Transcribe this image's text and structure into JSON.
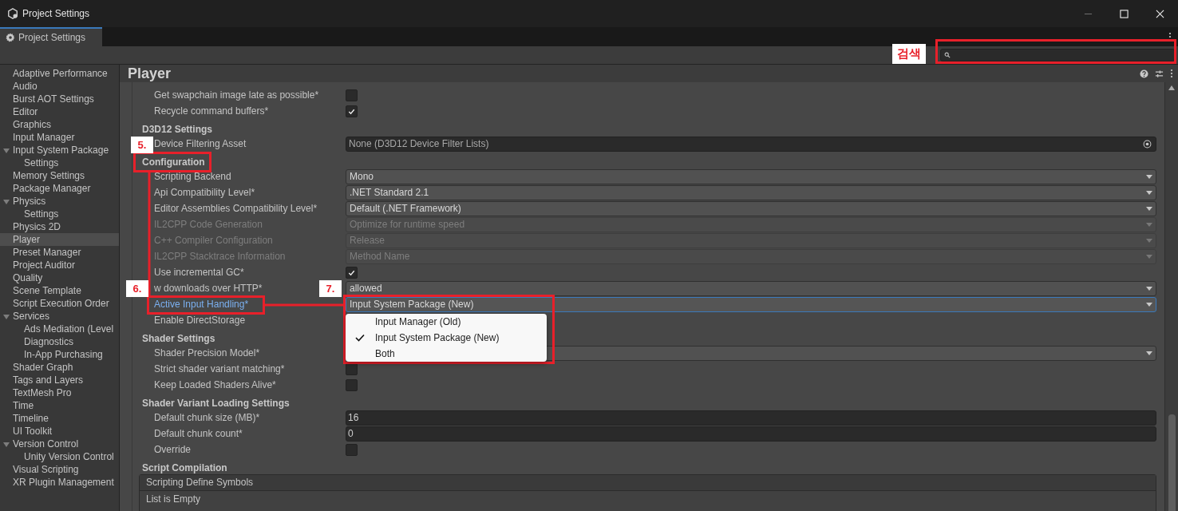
{
  "window": {
    "title": "Project Settings"
  },
  "tab": {
    "label": "Project Settings",
    "selected": true
  },
  "sidebar": {
    "items": [
      {
        "label": "Adaptive Performance",
        "selected": false
      },
      {
        "label": "Audio",
        "selected": false
      },
      {
        "label": "Burst AOT Settings",
        "selected": false
      },
      {
        "label": "Editor",
        "selected": false
      },
      {
        "label": "Graphics",
        "selected": false
      },
      {
        "label": "Input Manager",
        "selected": false
      },
      {
        "label": "Input System Package",
        "selected": false,
        "expanded": true,
        "children": [
          {
            "label": "Settings",
            "selected": false
          }
        ]
      },
      {
        "label": "Memory Settings",
        "selected": false
      },
      {
        "label": "Package Manager",
        "selected": false
      },
      {
        "label": "Physics",
        "selected": false,
        "expanded": true,
        "children": [
          {
            "label": "Settings",
            "selected": false
          }
        ]
      },
      {
        "label": "Physics 2D",
        "selected": false
      },
      {
        "label": "Player",
        "selected": true
      },
      {
        "label": "Preset Manager",
        "selected": false
      },
      {
        "label": "Project Auditor",
        "selected": false
      },
      {
        "label": "Quality",
        "selected": false
      },
      {
        "label": "Scene Template",
        "selected": false
      },
      {
        "label": "Script Execution Order",
        "selected": false
      },
      {
        "label": "Services",
        "selected": false,
        "expanded": true,
        "children": [
          {
            "label": "Ads Mediation (Level",
            "selected": false
          },
          {
            "label": "Diagnostics",
            "selected": false
          },
          {
            "label": "In-App Purchasing",
            "selected": false
          }
        ]
      },
      {
        "label": "Shader Graph",
        "selected": false
      },
      {
        "label": "Tags and Layers",
        "selected": false
      },
      {
        "label": "TextMesh Pro",
        "selected": false
      },
      {
        "label": "Time",
        "selected": false
      },
      {
        "label": "Timeline",
        "selected": false
      },
      {
        "label": "UI Toolkit",
        "selected": false
      },
      {
        "label": "Version Control",
        "selected": false,
        "expanded": true,
        "children": [
          {
            "label": "Unity Version Control",
            "selected": false
          }
        ]
      },
      {
        "label": "Visual Scripting",
        "selected": false
      },
      {
        "label": "XR Plugin Management",
        "selected": false
      }
    ]
  },
  "page": {
    "title": "Player",
    "rows": [
      {
        "kind": "checkbox",
        "label": "Get swapchain image late as possible*",
        "checked": false
      },
      {
        "kind": "checkbox",
        "label": "Recycle command buffers*",
        "checked": true
      },
      {
        "kind": "header",
        "label": "D3D12 Settings"
      },
      {
        "kind": "object",
        "label": "Device Filtering Asset",
        "value": "None (D3D12 Device Filter Lists)"
      },
      {
        "kind": "header",
        "label": "Configuration"
      },
      {
        "kind": "dropdown",
        "label": "Scripting Backend",
        "value": "Mono",
        "disabled": false,
        "focused": false
      },
      {
        "kind": "dropdown",
        "label": "Api Compatibility Level*",
        "value": ".NET Standard 2.1",
        "disabled": false,
        "focused": false
      },
      {
        "kind": "dropdown",
        "label": "Editor Assemblies Compatibility Level*",
        "value": "Default (.NET Framework)",
        "disabled": false,
        "focused": false
      },
      {
        "kind": "dropdown",
        "label": "IL2CPP Code Generation",
        "value": "Optimize for runtime speed",
        "disabled": true,
        "focused": false
      },
      {
        "kind": "dropdown",
        "label": "C++ Compiler Configuration",
        "value": "Release",
        "disabled": true,
        "focused": false
      },
      {
        "kind": "dropdown",
        "label": "IL2CPP Stacktrace Information",
        "value": "Method Name",
        "disabled": true,
        "focused": false
      },
      {
        "kind": "checkbox",
        "label": "Use incremental GC*",
        "checked": true
      },
      {
        "kind": "dropdown",
        "label": "w downloads over HTTP*",
        "value": "allowed",
        "disabled": false,
        "focused": false
      },
      {
        "kind": "dropdown",
        "label": "Active Input Handling*",
        "value": "Input System Package (New)",
        "disabled": false,
        "focused": true
      },
      {
        "kind": "plain",
        "label": "Enable DirectStorage"
      },
      {
        "kind": "header",
        "label": "Shader Settings"
      },
      {
        "kind": "dropdown",
        "label": "Shader Precision Model*",
        "disabled": false,
        "focused": false
      },
      {
        "kind": "checkbox",
        "label": "Strict shader variant matching*",
        "checked": false
      },
      {
        "kind": "checkbox",
        "label": "Keep Loaded Shaders Alive*",
        "checked": false
      },
      {
        "kind": "header",
        "label": "Shader Variant Loading Settings"
      },
      {
        "kind": "number",
        "label": "Default chunk size (MB)*",
        "value": "16"
      },
      {
        "kind": "number",
        "label": "Default chunk count*",
        "value": "0"
      },
      {
        "kind": "checkbox",
        "label": "Override",
        "checked": false
      },
      {
        "kind": "header",
        "label": "Script Compilation"
      },
      {
        "kind": "list",
        "label": "Scripting Define Symbols",
        "empty_text": "List is Empty"
      }
    ]
  },
  "popup": {
    "items": [
      {
        "label": "Input Manager (Old)",
        "selected": false
      },
      {
        "label": "Input System Package (New)",
        "selected": true
      },
      {
        "label": "Both",
        "selected": false
      }
    ]
  },
  "annotations": {
    "search_label": "검색",
    "steps": [
      {
        "label": "5."
      },
      {
        "label": "6."
      },
      {
        "label": "7."
      }
    ]
  }
}
